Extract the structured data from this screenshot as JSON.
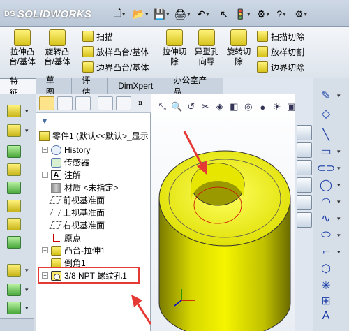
{
  "app": {
    "logo_text": "SOLIDWORKS",
    "logo_prefix": "DS"
  },
  "ribbon": {
    "buttons": [
      {
        "label": "拉伸凸台/基体"
      },
      {
        "label": "旋转凸台/基体"
      },
      {
        "label": "拉伸切除"
      },
      {
        "label": "异型孔向导"
      },
      {
        "label": "旋转切除"
      }
    ],
    "small_left": [
      "扫描",
      "放样凸台/基体",
      "边界凸台/基体"
    ],
    "small_right": [
      "扫描切除",
      "放样切割",
      "边界切除"
    ]
  },
  "tabs": [
    "特征",
    "草图",
    "评估",
    "DimXpert",
    "办公室产品"
  ],
  "active_tab": "特征",
  "feature_tree": {
    "root": "零件1 (默认<<默认>_显示",
    "items": [
      {
        "label": "History",
        "expandable": true,
        "icon": "history-icon"
      },
      {
        "label": "传感器",
        "expandable": false,
        "icon": "sensor-icon"
      },
      {
        "label": "注解",
        "expandable": true,
        "icon": "annotation-icon"
      },
      {
        "label": "材质 <未指定>",
        "expandable": false,
        "icon": "material-icon"
      },
      {
        "label": "前视基准面",
        "expandable": false,
        "icon": "plane-icon"
      },
      {
        "label": "上视基准面",
        "expandable": false,
        "icon": "plane-icon"
      },
      {
        "label": "右视基准面",
        "expandable": false,
        "icon": "plane-icon"
      },
      {
        "label": "原点",
        "expandable": false,
        "icon": "origin-icon"
      },
      {
        "label": "凸台-拉伸1",
        "expandable": true,
        "icon": "extrude-icon"
      },
      {
        "label": "倒角1",
        "expandable": false,
        "icon": "chamfer-icon"
      },
      {
        "label": "3/8 NPT 螺纹孔1",
        "expandable": true,
        "icon": "hole-icon"
      }
    ]
  },
  "colors": {
    "accent": "#e53935",
    "model": "#e6e600",
    "tab_bar": "#c9d3df"
  }
}
